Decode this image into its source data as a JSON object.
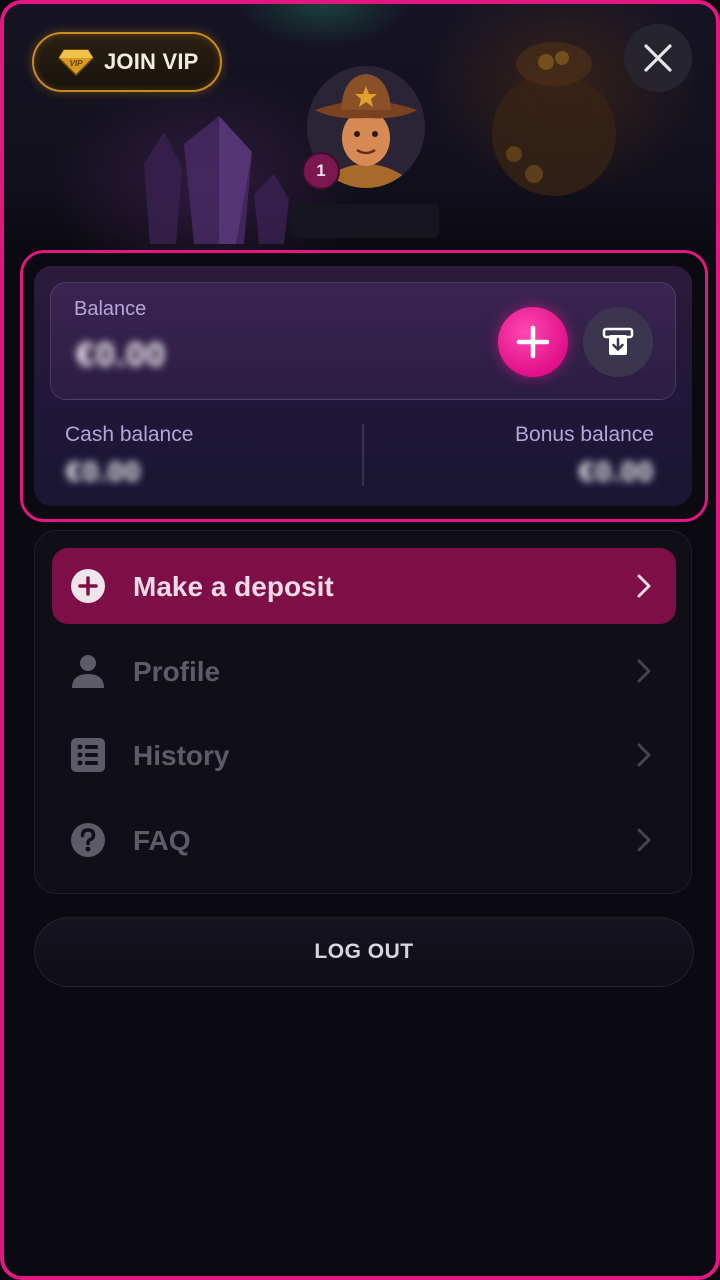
{
  "header": {
    "vip_button_label": "JOIN VIP",
    "vip_badge_text": "VIP",
    "level": "1"
  },
  "balance": {
    "title": "Balance",
    "amount": "€0.00",
    "cash_label": "Cash balance",
    "cash_amount": "€0.00",
    "bonus_label": "Bonus balance",
    "bonus_amount": "€0.00"
  },
  "menu": {
    "items": [
      {
        "label": "Make a deposit",
        "icon": "plus-circle-icon",
        "active": true
      },
      {
        "label": "Profile",
        "icon": "user-icon",
        "active": false
      },
      {
        "label": "History",
        "icon": "list-icon",
        "active": false
      },
      {
        "label": "FAQ",
        "icon": "question-circle-icon",
        "active": false
      }
    ]
  },
  "logout_label": "LOG OUT",
  "colors": {
    "accent": "#e0187f",
    "deposit_row": "#7e0e47",
    "vip_gold": "#c98a1c",
    "muted_text": "#5e5b68",
    "label_lilac": "#b4a6d8"
  }
}
